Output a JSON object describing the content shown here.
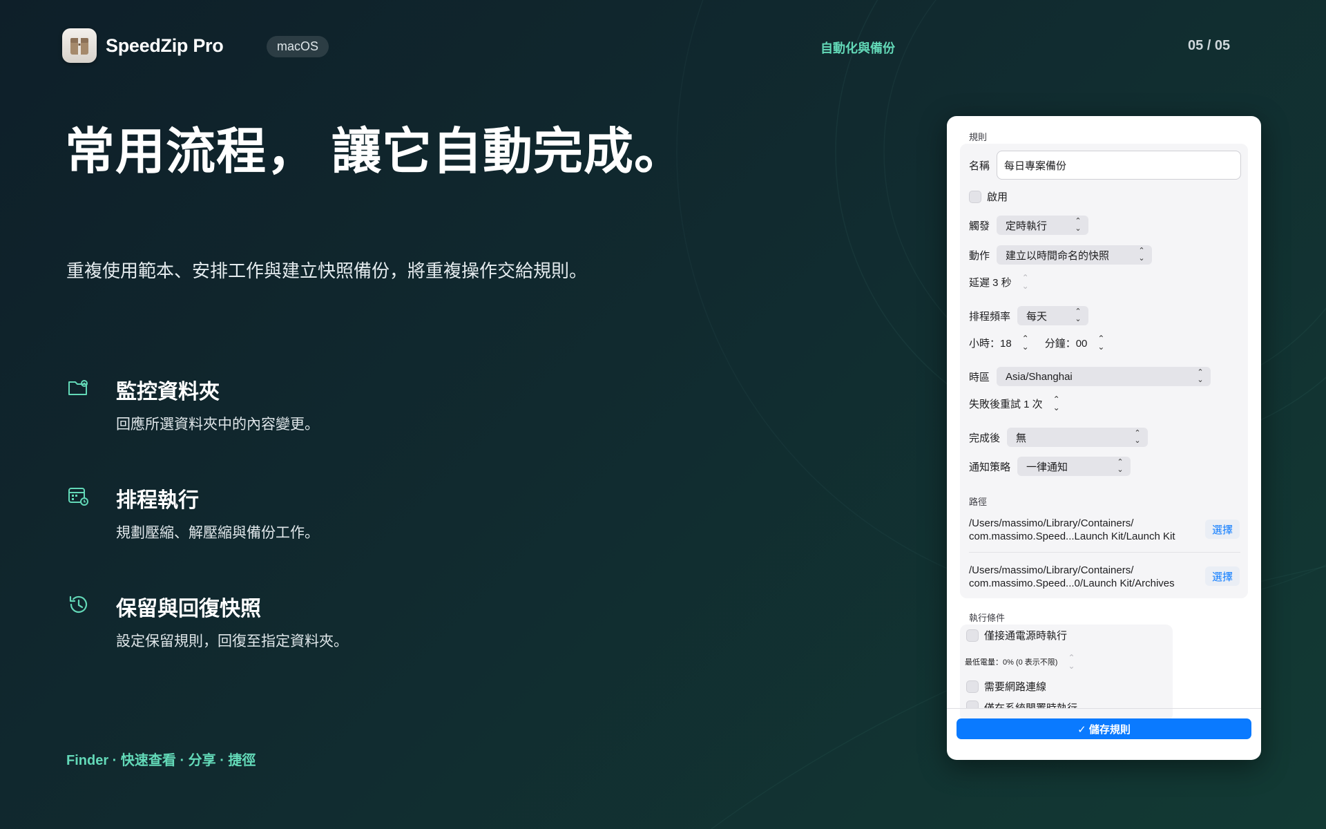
{
  "header": {
    "app_name": "SpeedZip Pro",
    "platform": "macOS",
    "section": "自動化與備份",
    "page": "05 / 05"
  },
  "hero": {
    "headline": "常用流程， 讓它自動完成。",
    "subline": "重複使用範本、安排工作與建立快照備份，將重複操作交給規則。"
  },
  "features": [
    {
      "icon": "folder-gear-icon",
      "title": "監控資料夾",
      "desc": "回應所選資料夾中的內容變更。"
    },
    {
      "icon": "calendar-clock-icon",
      "title": "排程執行",
      "desc": "規劃壓縮、解壓縮與備份工作。"
    },
    {
      "icon": "history-icon",
      "title": "保留與回復快照",
      "desc": "設定保留規則，回復至指定資料夾。"
    }
  ],
  "footer": {
    "links": "Finder · 快速查看 · 分享 · 捷徑"
  },
  "panel": {
    "rule_group": "規則",
    "name_label": "名稱",
    "name_value": "每日專案備份",
    "enable_label": "啟用",
    "trigger_label": "觸發",
    "trigger_value": "定時執行",
    "action_label": "動作",
    "action_value": "建立以時間命名的快照",
    "delay_label": "延遲 3 秒",
    "frequency_label": "排程頻率",
    "frequency_value": "每天",
    "hour_label": "小時：18",
    "minute_label": "分鐘：00",
    "timezone_label": "時區",
    "timezone_value": "Asia/Shanghai",
    "retry_label": "失敗後重試 1 次",
    "after_label": "完成後",
    "after_value": "無",
    "notify_label": "通知策略",
    "notify_value": "一律通知",
    "path_group": "路徑",
    "source_path": "/Users/massimo/Library/Containers/ com.massimo.Speed...Launch Kit/Launch Kit",
    "dest_path": "/Users/massimo/Library/Containers/ com.massimo.Speed...0/Launch Kit/Archives",
    "choose_label": "選擇",
    "conditions_group": "執行條件",
    "power_label": "僅接通電源時執行",
    "battery_label": "最低電量：0% (0 表示不限)",
    "network_label": "需要網路連線",
    "idle_label": "僅在系統閒置時執行",
    "save_label": "✓  儲存規則"
  }
}
